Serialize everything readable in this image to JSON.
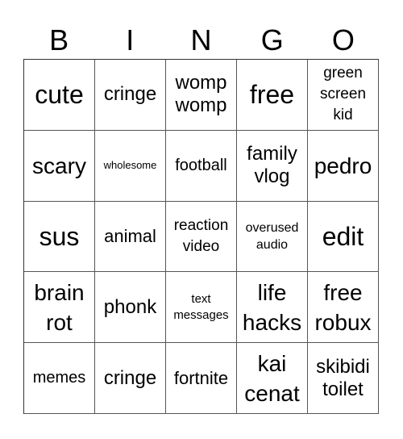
{
  "header": {
    "letters": [
      "B",
      "I",
      "N",
      "G",
      "O"
    ]
  },
  "grid": {
    "rows": [
      [
        {
          "text": "cute",
          "size": "fs-32"
        },
        {
          "text": "cringe",
          "size": "fs-24"
        },
        {
          "text": "womp\nwomp",
          "size": "fs-24"
        },
        {
          "text": "free",
          "size": "fs-32"
        },
        {
          "text": "green\nscreen\nkid",
          "size": "fs-19"
        }
      ],
      [
        {
          "text": "scary",
          "size": "fs-28"
        },
        {
          "text": "wholesome",
          "size": "fs-13"
        },
        {
          "text": "football",
          "size": "fs-20"
        },
        {
          "text": "family\nvlog",
          "size": "fs-24"
        },
        {
          "text": "pedro",
          "size": "fs-28"
        }
      ],
      [
        {
          "text": "sus",
          "size": "fs-32"
        },
        {
          "text": "animal",
          "size": "fs-22"
        },
        {
          "text": "reaction\nvideo",
          "size": "fs-19"
        },
        {
          "text": "overused\naudio",
          "size": "fs-16"
        },
        {
          "text": "edit",
          "size": "fs-32"
        }
      ],
      [
        {
          "text": "brain\nrot",
          "size": "fs-28"
        },
        {
          "text": "phonk",
          "size": "fs-24"
        },
        {
          "text": "text\nmessages",
          "size": "fs-15"
        },
        {
          "text": "life\nhacks",
          "size": "fs-28"
        },
        {
          "text": "free\nrobux",
          "size": "fs-28"
        }
      ],
      [
        {
          "text": "memes",
          "size": "fs-20"
        },
        {
          "text": "cringe",
          "size": "fs-24"
        },
        {
          "text": "fortnite",
          "size": "fs-22"
        },
        {
          "text": "kai\ncenat",
          "size": "fs-28"
        },
        {
          "text": "skibidi\ntoilet",
          "size": "fs-24"
        }
      ]
    ]
  }
}
